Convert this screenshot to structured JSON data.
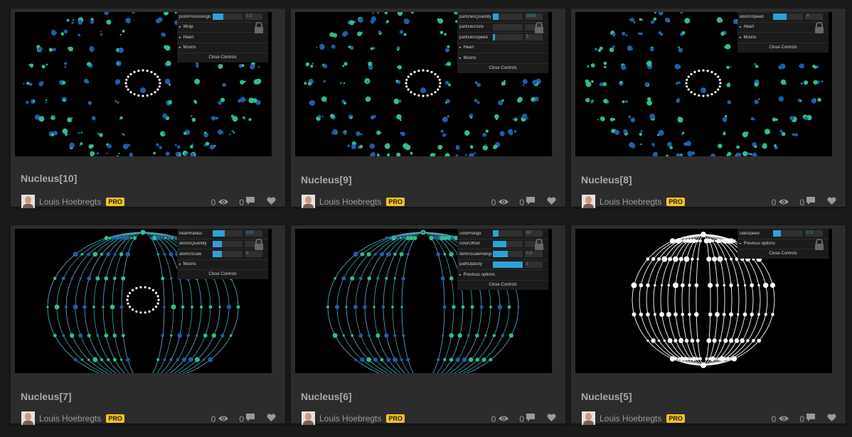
{
  "cards": [
    {
      "title": "Nucleus[10]",
      "author": "Louis Hoebregts",
      "badge": "PRO",
      "views": "0",
      "comments": "0",
      "panel": {
        "rows": [
          {
            "label": "postProcessingE",
            "value": "0.3",
            "fill": 0.35
          }
        ],
        "folders": [
          "Wrap",
          "Heart",
          "Moons"
        ],
        "close": "Close Controls"
      }
    },
    {
      "title": "Nucleus[9]",
      "author": "Louis Hoebregts",
      "badge": "PRO",
      "views": "0",
      "comments": "0",
      "panel": {
        "rows": [
          {
            "label": "particlesQuantity",
            "value": "3000",
            "fill": 0.2
          },
          {
            "label": "particlesSize",
            "value": "",
            "fill": 0
          },
          {
            "label": "particlesSpeed",
            "value": "1",
            "fill": 0.08
          }
        ],
        "folders": [
          "Heart",
          "Moons"
        ],
        "close": "Close Controls"
      }
    },
    {
      "title": "Nucleus[8]",
      "author": "Louis Hoebregts",
      "badge": "PRO",
      "views": "0",
      "comments": "0",
      "panel": {
        "rows": [
          {
            "label": "atomsSpeed",
            "value": "4",
            "fill": 0.45
          }
        ],
        "folders": [
          "Heart",
          "Moons"
        ],
        "close": "Close Controls"
      }
    },
    {
      "title": "Nucleus[7]",
      "author": "Louis Hoebregts",
      "badge": "PRO",
      "views": "0",
      "comments": "0",
      "panel": {
        "rows": [
          {
            "label": "heartRadius",
            "value": "100",
            "fill": 0.4
          },
          {
            "label": "atomsQuantity",
            "value": "",
            "fill": 0.3
          },
          {
            "label": "atomsScale",
            "value": "6",
            "fill": 0.3
          }
        ],
        "folders": [
          "Moons"
        ],
        "close": "Close Controls"
      }
    },
    {
      "title": "Nucleus[6]",
      "author": "Louis Hoebregts",
      "badge": "PRO",
      "views": "0",
      "comments": "0",
      "panel": {
        "rows": [
          {
            "label": "colorRange",
            "value": "60",
            "fill": 0.2
          },
          {
            "label": "colorOffset",
            "value": "",
            "fill": 0.45
          },
          {
            "label": "itemsScaleRange",
            "value": "0.5",
            "fill": 0.5
          },
          {
            "label": "pathOpacity",
            "value": "1",
            "fill": 1
          }
        ],
        "folders": [
          "Previous options"
        ],
        "close": "Close Controls"
      }
    },
    {
      "title": "Nucleus[5]",
      "author": "Louis Hoebregts",
      "badge": "PRO",
      "views": "0",
      "comments": "0",
      "panel": {
        "rows": [
          {
            "label": "rateSpeed",
            "value": "0.3",
            "fill": 0.25
          }
        ],
        "folders": [
          "Previous options"
        ],
        "close": "Close Controls"
      }
    }
  ],
  "colors": {
    "accent": "#2fa1d6",
    "badge": "#f3c31b",
    "card": "#2c2c2c",
    "background": "#1a1a1a",
    "particle_dark": "#1f5fa8",
    "particle_light": "#2fbf8a"
  },
  "icons": {
    "views": "eye-icon",
    "comments": "speech-bubble-icon",
    "likes": "heart-icon",
    "lock": "lock-icon"
  }
}
